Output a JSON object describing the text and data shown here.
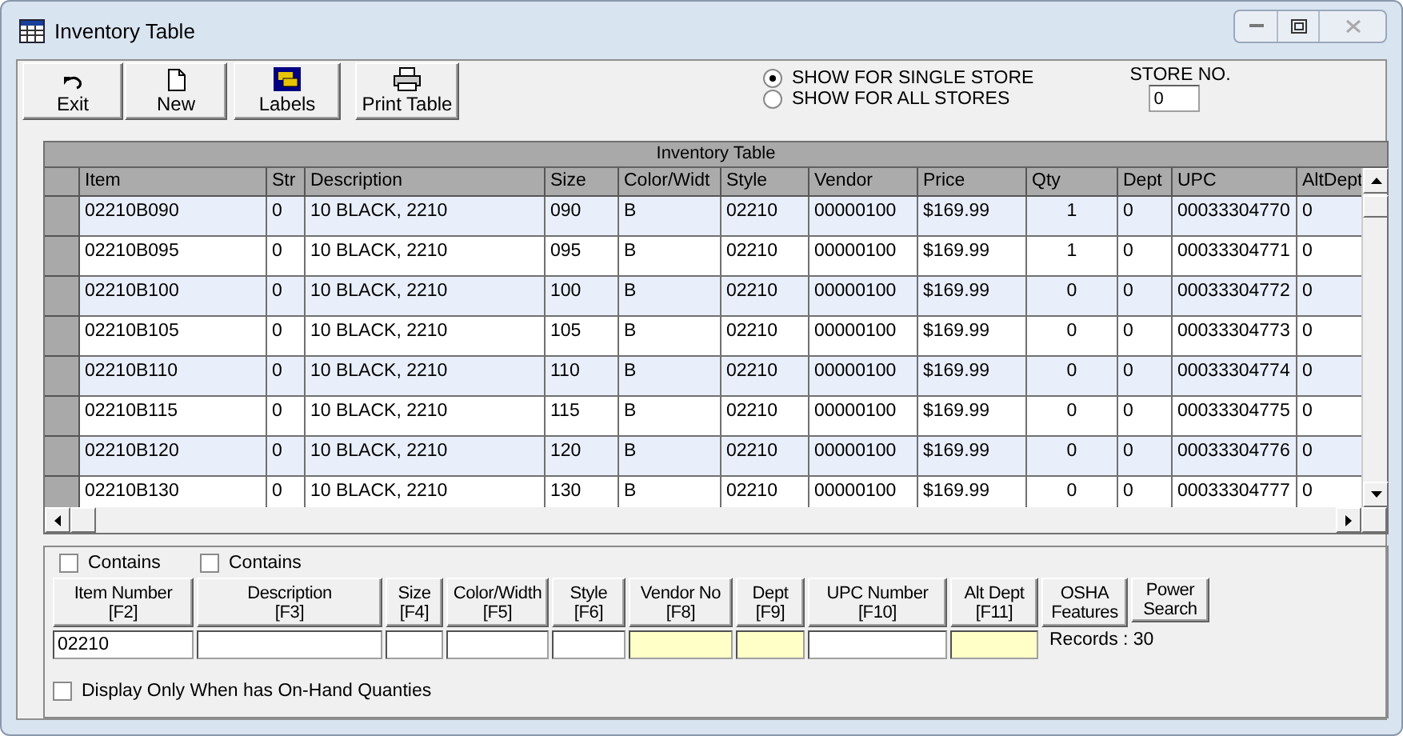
{
  "window": {
    "title": "Inventory Table"
  },
  "toolbar": [
    {
      "kind": "exit",
      "label": "Exit"
    },
    {
      "kind": "new",
      "label": "New"
    },
    {
      "kind": "labels",
      "label": "Labels"
    },
    {
      "kind": "print",
      "label": "Print Table"
    }
  ],
  "store_scope": [
    {
      "label": "SHOW FOR SINGLE STORE",
      "selected": true
    },
    {
      "label": "SHOW FOR ALL STORES",
      "selected": false
    }
  ],
  "store_no": {
    "label": "STORE NO.",
    "value": "0"
  },
  "table": {
    "title": "Inventory Table",
    "columns": [
      "Item",
      "Str",
      "Description",
      "Size",
      "Color/Widt",
      "Style",
      "Vendor",
      "Price",
      "Qty",
      "Dept",
      "UPC",
      "AltDept"
    ],
    "rows": [
      [
        "02210B090",
        "0",
        "10  BLACK, 2210",
        "090",
        "B",
        "02210",
        "00000100",
        "$169.99",
        "1",
        "0",
        "00033304770",
        "0"
      ],
      [
        "02210B095",
        "0",
        "10  BLACK, 2210",
        "095",
        "B",
        "02210",
        "00000100",
        "$169.99",
        "1",
        "0",
        "00033304771",
        "0"
      ],
      [
        "02210B100",
        "0",
        "10  BLACK, 2210",
        "100",
        "B",
        "02210",
        "00000100",
        "$169.99",
        "0",
        "0",
        "00033304772",
        "0"
      ],
      [
        "02210B105",
        "0",
        "10  BLACK, 2210",
        "105",
        "B",
        "02210",
        "00000100",
        "$169.99",
        "0",
        "0",
        "00033304773",
        "0"
      ],
      [
        "02210B110",
        "0",
        "10  BLACK, 2210",
        "110",
        "B",
        "02210",
        "00000100",
        "$169.99",
        "0",
        "0",
        "00033304774",
        "0"
      ],
      [
        "02210B115",
        "0",
        "10  BLACK, 2210",
        "115",
        "B",
        "02210",
        "00000100",
        "$169.99",
        "0",
        "0",
        "00033304775",
        "0"
      ],
      [
        "02210B120",
        "0",
        "10  BLACK, 2210",
        "120",
        "B",
        "02210",
        "00000100",
        "$169.99",
        "0",
        "0",
        "00033304776",
        "0"
      ],
      [
        "02210B130",
        "0",
        "10  BLACK, 2210",
        "130",
        "B",
        "02210",
        "00000100",
        "$169.99",
        "0",
        "0",
        "00033304777",
        "0"
      ]
    ]
  },
  "contains": [
    {
      "label": "Contains",
      "checked": false
    },
    {
      "label": "Contains",
      "checked": false
    }
  ],
  "search": [
    {
      "label": "Item Number",
      "key": "[F2]",
      "value": "02210",
      "highlighted": false
    },
    {
      "label": "Description",
      "key": "[F3]",
      "highlighted": false
    },
    {
      "label": "Size",
      "key": "[F4]",
      "highlighted": false
    },
    {
      "label": "Color/Width",
      "key": "[F5]",
      "highlighted": false
    },
    {
      "label": "Style",
      "key": "[F6]",
      "highlighted": false
    },
    {
      "label": "Vendor No",
      "key": "[F8]",
      "highlighted": true
    },
    {
      "label": "Dept",
      "key": "[F9]",
      "highlighted": true
    },
    {
      "label": "UPC Number",
      "key": "[F10]",
      "highlighted": false
    },
    {
      "label": "Alt Dept",
      "key": "[F11]",
      "highlighted": true
    }
  ],
  "extra_buttons": [
    {
      "label": "OSHA",
      "label2": "Features"
    },
    {
      "label": "Power",
      "label2": "Search"
    }
  ],
  "records": "Records : 30",
  "on_hand_only": {
    "label": "Display Only When has On-Hand Quanties",
    "checked": false
  }
}
